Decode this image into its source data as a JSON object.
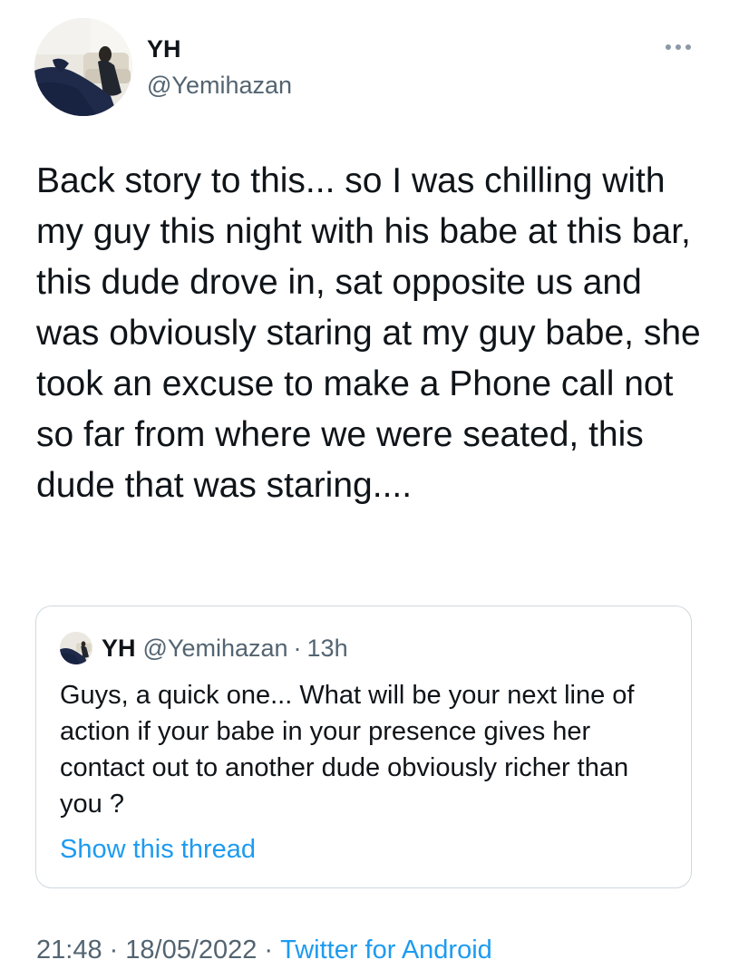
{
  "tweet": {
    "author": {
      "display_name": "YH",
      "handle": "@Yemihazan"
    },
    "more_icon": "more-horizontal-icon",
    "text": "Back story to this... so I was chilling with my guy this night with his babe at this bar, this dude drove in, sat opposite us and was obviously staring at my guy babe, she took an excuse to make a Phone call not so far from where we were seated, this dude that was staring....",
    "quoted": {
      "display_name": "YH",
      "handle": "@Yemihazan",
      "separator": "·",
      "time": "13h",
      "text": "Guys, a quick one... What will be your next line of action if your babe in your presence gives her contact out to another dude obviously richer than you ?",
      "show_thread": "Show this thread"
    },
    "meta": {
      "time": "21:48",
      "separator": "·",
      "date": "18/05/2022",
      "source": "Twitter for Android"
    }
  },
  "colors": {
    "text_primary": "#0f1419",
    "text_secondary": "#536471",
    "link": "#1d9bf0",
    "border": "#cfd9de"
  }
}
